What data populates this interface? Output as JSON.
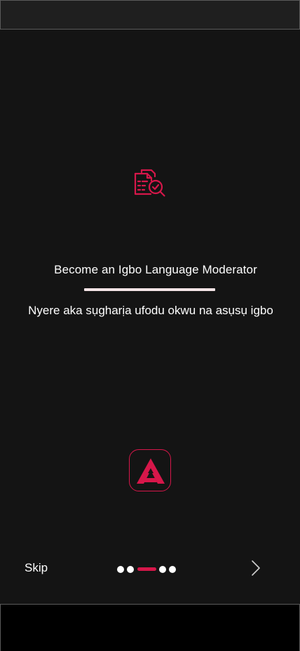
{
  "colors": {
    "accent": "#d6174a",
    "background": "#141414",
    "text": "#ffffff",
    "underline": "#f4e4e6"
  },
  "onboarding": {
    "icon": "document-search-icon",
    "title": "Become an Igbo Language Moderator",
    "subtitle": "Nyere aka sụgharịa ufodu okwu na asụsụ igbo",
    "logo": "app-logo-icon"
  },
  "footer": {
    "skip_label": "Skip",
    "pager": {
      "total": 5,
      "active_index": 3
    },
    "next_icon": "chevron-right-icon"
  }
}
